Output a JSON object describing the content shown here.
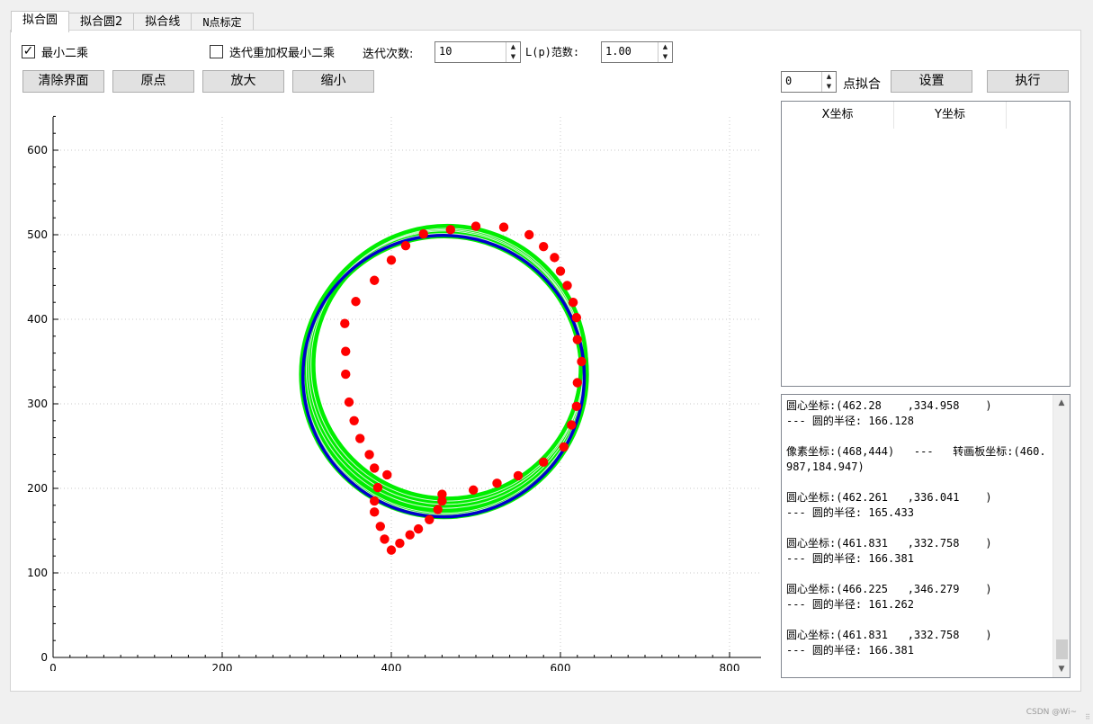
{
  "tabs": [
    {
      "label": "拟合圆",
      "active": true
    },
    {
      "label": "拟合圆2",
      "active": false
    },
    {
      "label": "拟合线",
      "active": false
    },
    {
      "label": "N点标定",
      "active": false
    }
  ],
  "options": {
    "least_squares": {
      "label": "最小二乘",
      "checked": true
    },
    "irls": {
      "label": "迭代重加权最小二乘",
      "checked": false
    },
    "iterations_label": "迭代次数:",
    "iterations_value": "10",
    "lp_label": "L(p)范数:",
    "lp_value": "1.00"
  },
  "toolbar": {
    "clear_label": "清除界面",
    "origin_label": "原点",
    "zoom_in_label": "放大",
    "zoom_out_label": "缩小"
  },
  "fit_controls": {
    "points_value": "0",
    "points_label": "点拟合",
    "settings_label": "设置",
    "execute_label": "执行"
  },
  "table": {
    "col_x": "X坐标",
    "col_y": "Y坐标",
    "rows": []
  },
  "log": {
    "lines": [
      "圆心坐标:(462.28    ,334.958    )",
      "--- 圆的半径: 166.128",
      "",
      "像素坐标:(468,444)   ---   转画板坐标:(460.987,184.947)",
      "",
      "圆心坐标:(462.261   ,336.041    )",
      "--- 圆的半径: 165.433",
      "",
      "圆心坐标:(461.831   ,332.758    )",
      "--- 圆的半径: 166.381",
      "",
      "圆心坐标:(466.225   ,346.279    )",
      "--- 圆的半径: 161.262",
      "",
      "圆心坐标:(461.831   ,332.758    )",
      "--- 圆的半径: 166.381"
    ]
  },
  "watermark": "CSDN @Wi~",
  "colors": {
    "points": "#ff0000",
    "fit_circle": "#0000cc",
    "green_fits": "#00ee00",
    "grid": "#c8c8c8"
  },
  "chart_data": {
    "type": "scatter",
    "x_ticks": [
      "0",
      "200",
      "400",
      "600",
      "800"
    ],
    "y_ticks": [
      "0",
      "100",
      "200",
      "300",
      "400",
      "500",
      "600"
    ],
    "xlim": [
      0,
      840
    ],
    "ylim": [
      0,
      645
    ],
    "grid": true,
    "points": [
      [
        625,
        350
      ],
      [
        620,
        376
      ],
      [
        619,
        402
      ],
      [
        615,
        420
      ],
      [
        608,
        440
      ],
      [
        600,
        457
      ],
      [
        593,
        473
      ],
      [
        580,
        486
      ],
      [
        563,
        500
      ],
      [
        533,
        509
      ],
      [
        500,
        510
      ],
      [
        470,
        506
      ],
      [
        438,
        501
      ],
      [
        417,
        487
      ],
      [
        400,
        470
      ],
      [
        380,
        446
      ],
      [
        358,
        421
      ],
      [
        345,
        395
      ],
      [
        346,
        362
      ],
      [
        346,
        335
      ],
      [
        350,
        302
      ],
      [
        356,
        280
      ],
      [
        363,
        259
      ],
      [
        374,
        240
      ],
      [
        380,
        224
      ],
      [
        395,
        216
      ],
      [
        384,
        201
      ],
      [
        380,
        185
      ],
      [
        380,
        172
      ],
      [
        387,
        155
      ],
      [
        392,
        140
      ],
      [
        400,
        127
      ],
      [
        410,
        135
      ],
      [
        422,
        145
      ],
      [
        432,
        152
      ],
      [
        445,
        163
      ],
      [
        455,
        175
      ],
      [
        460,
        185
      ],
      [
        460,
        193
      ],
      [
        497,
        198
      ],
      [
        525,
        206
      ],
      [
        550,
        215
      ],
      [
        580,
        231
      ],
      [
        604,
        249
      ],
      [
        613,
        275
      ],
      [
        619,
        297
      ],
      [
        620,
        325
      ]
    ],
    "fit_circle": {
      "cx": 461.831,
      "cy": 332.758,
      "r": 166.381
    },
    "green_circles": [
      {
        "cx": 462.28,
        "cy": 334.958,
        "r": 166.128
      },
      {
        "cx": 462.261,
        "cy": 336.041,
        "r": 165.433
      },
      {
        "cx": 466.225,
        "cy": 346.279,
        "r": 161.262
      },
      {
        "cx": 463.5,
        "cy": 340.5,
        "r": 164.0
      },
      {
        "cx": 464.5,
        "cy": 343.5,
        "r": 162.5
      }
    ]
  }
}
